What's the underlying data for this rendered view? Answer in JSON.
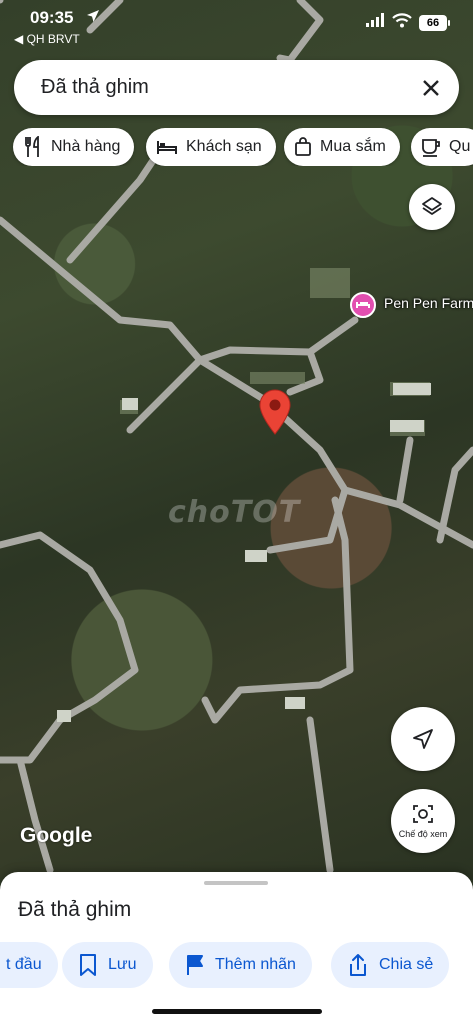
{
  "status_bar": {
    "time": "09:35",
    "back_app": "◀ QH BRVT",
    "battery": "66"
  },
  "search": {
    "value": "Đã thả ghim"
  },
  "chips": [
    {
      "label": "Nhà hàng",
      "icon": "fork-knife-icon"
    },
    {
      "label": "Khách sạn",
      "icon": "bed-icon"
    },
    {
      "label": "Mua sắm",
      "icon": "shopping-bag-icon"
    },
    {
      "label": "Qu",
      "icon": "coffee-icon"
    }
  ],
  "map": {
    "watermark": "choTOT",
    "poi_label": "Pen Pen Farm",
    "google_logo": "Google",
    "streetview_label": "Chế độ xem"
  },
  "sheet": {
    "title": "Đã thả ghim",
    "actions": [
      {
        "label": "t đầu",
        "icon": "directions-icon"
      },
      {
        "label": "Lưu",
        "icon": "bookmark-icon"
      },
      {
        "label": "Thêm nhãn",
        "icon": "flag-icon"
      },
      {
        "label": "Chia sẻ",
        "icon": "share-icon"
      }
    ]
  },
  "colors": {
    "accent": "#0b57d0",
    "action_bg": "#e8f0fe",
    "pin": "#ea4335",
    "poi": "#e24fb0"
  }
}
